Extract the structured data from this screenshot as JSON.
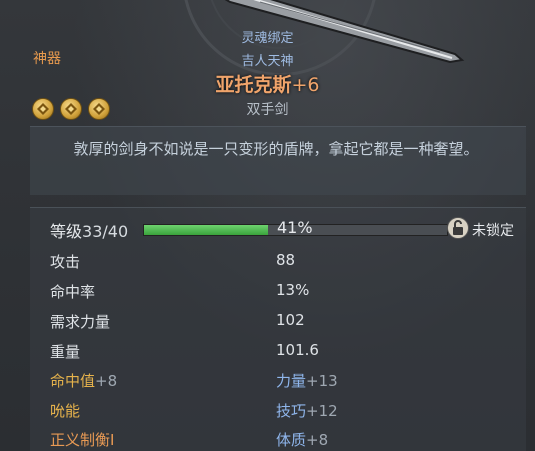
{
  "header": {
    "rarity": "神器",
    "bound_text": "灵魂绑定",
    "set_name": "吉人天神",
    "item_name": "亚托克斯",
    "item_upgrade": "+6",
    "item_type": "双手剑"
  },
  "sockets": [
    "rune-icon",
    "rune-icon",
    "rune-icon"
  ],
  "description": "敦厚的剑身不如说是一只变形的盾牌，拿起它都是一种奢望。",
  "level": {
    "label": "等级",
    "value": "33/40",
    "progress_percent_text": "41%",
    "progress_fraction": 0.41,
    "lock_text": "未锁定"
  },
  "stats": [
    {
      "label": "攻击",
      "value": "88"
    },
    {
      "label": "命中率",
      "value": "13%"
    },
    {
      "label": "需求力量",
      "value": "102"
    },
    {
      "label": "重量",
      "value": "101.6"
    }
  ],
  "bonuses": [
    {
      "left_label": "命中值",
      "left_value": "+8",
      "right_label": "力量",
      "right_value": "+13"
    },
    {
      "left_label": "吮能",
      "left_value": "",
      "right_label": "技巧",
      "right_value": "+12"
    },
    {
      "left_label": "正义制衡I",
      "left_value": "",
      "right_label": "体质",
      "right_value": "+8"
    }
  ],
  "colors": {
    "rarity": "#e79a4e",
    "item_name": "#f0a46b",
    "bonus_left": "#e5b24c",
    "bonus_right": "#8fb6ec",
    "progress": "#3aa33c"
  }
}
